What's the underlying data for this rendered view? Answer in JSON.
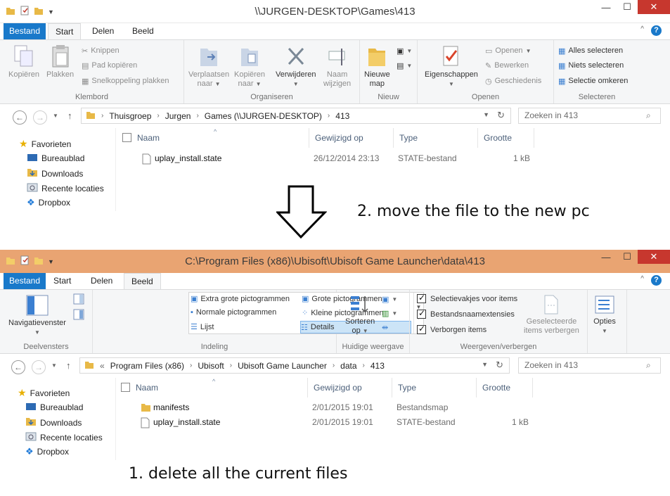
{
  "top": {
    "title": "\\\\JURGEN-DESKTOP\\Games\\413",
    "tabs": [
      "Bestand",
      "Start",
      "Delen",
      "Beeld"
    ],
    "ribbon": {
      "klembord": {
        "label": "Klembord",
        "kopieren": "Kopiëren",
        "plakken": "Plakken",
        "knippen": "Knippen",
        "pad": "Pad kopiëren",
        "snelkop": "Snelkoppeling plakken"
      },
      "organiseren": {
        "label": "Organiseren",
        "verplaatsen": "Verplaatsen",
        "verplaatsen2": "naar",
        "kopieren": "Kopiëren",
        "kopieren2": "naar",
        "verwijderen": "Verwijderen",
        "naam": "Naam",
        "naam2": "wijzigen"
      },
      "nieuw": {
        "label": "Nieuw",
        "nieuwe": "Nieuwe",
        "map": "map"
      },
      "openen": {
        "label": "Openen",
        "eigenschappen": "Eigenschappen",
        "open": "Openen",
        "bewerken": "Bewerken",
        "geschiedenis": "Geschiedenis"
      },
      "selecteren": {
        "label": "Selecteren",
        "alles": "Alles selecteren",
        "niets": "Niets selecteren",
        "omkeren": "Selectie omkeren"
      }
    },
    "path": [
      "Thuisgroep",
      "Jurgen",
      "Games (\\\\JURGEN-DESKTOP)",
      "413"
    ],
    "search_placeholder": "Zoeken in 413",
    "nav": [
      "Favorieten",
      "Bureaublad",
      "Downloads",
      "Recente locaties",
      "Dropbox"
    ],
    "columns": [
      "Naam",
      "Gewijzigd op",
      "Type",
      "Grootte"
    ],
    "rows": [
      {
        "name": "uplay_install.state",
        "date": "26/12/2014 23:13",
        "type": "STATE-bestand",
        "size": "1 kB"
      }
    ]
  },
  "annotation_2": "2. move the file to the new pc",
  "bottom": {
    "title": "C:\\Program Files (x86)\\Ubisoft\\Ubisoft Game Launcher\\data\\413",
    "tabs": [
      "Bestand",
      "Start",
      "Delen",
      "Beeld"
    ],
    "ribbon": {
      "deelvensters": {
        "label": "Deelvensters",
        "nav": "Navigatievenster"
      },
      "indeling": {
        "label": "Indeling",
        "extra": "Extra grote pictogrammen",
        "grote": "Grote pictogrammen",
        "normale": "Normale pictogrammen",
        "kleine": "Kleine pictogrammen",
        "lijst": "Lijst",
        "details": "Details"
      },
      "huidige": {
        "label": "Huidige weergave",
        "sorteren": "Sorteren",
        "op": "op"
      },
      "weergeven": {
        "label": "Weergeven/verbergen",
        "selectie": "Selectievakjes voor items",
        "ext": "Bestandsnaamextensies",
        "verborgen": "Verborgen items",
        "geselecteerde": "Geselecteerde",
        "verbergen": "items verbergen"
      },
      "opties": "Opties"
    },
    "path_prefix": "«",
    "path": [
      "Program Files (x86)",
      "Ubisoft",
      "Ubisoft Game Launcher",
      "data",
      "413"
    ],
    "search_placeholder": "Zoeken in 413",
    "nav": [
      "Favorieten",
      "Bureaublad",
      "Downloads",
      "Recente locaties",
      "Dropbox"
    ],
    "columns": [
      "Naam",
      "Gewijzigd op",
      "Type",
      "Grootte"
    ],
    "rows": [
      {
        "name": "manifests",
        "date": "2/01/2015 19:01",
        "type": "Bestandsmap",
        "size": ""
      },
      {
        "name": "uplay_install.state",
        "date": "2/01/2015 19:01",
        "type": "STATE-bestand",
        "size": "1 kB"
      }
    ]
  },
  "annotation_1": "1. delete all the current files",
  "colors": {
    "file_tab": "#1979ca",
    "bottom_title": "#e9a472",
    "close": "#c7372e",
    "column_header": "#4c607a",
    "folder": "#e8b947"
  }
}
